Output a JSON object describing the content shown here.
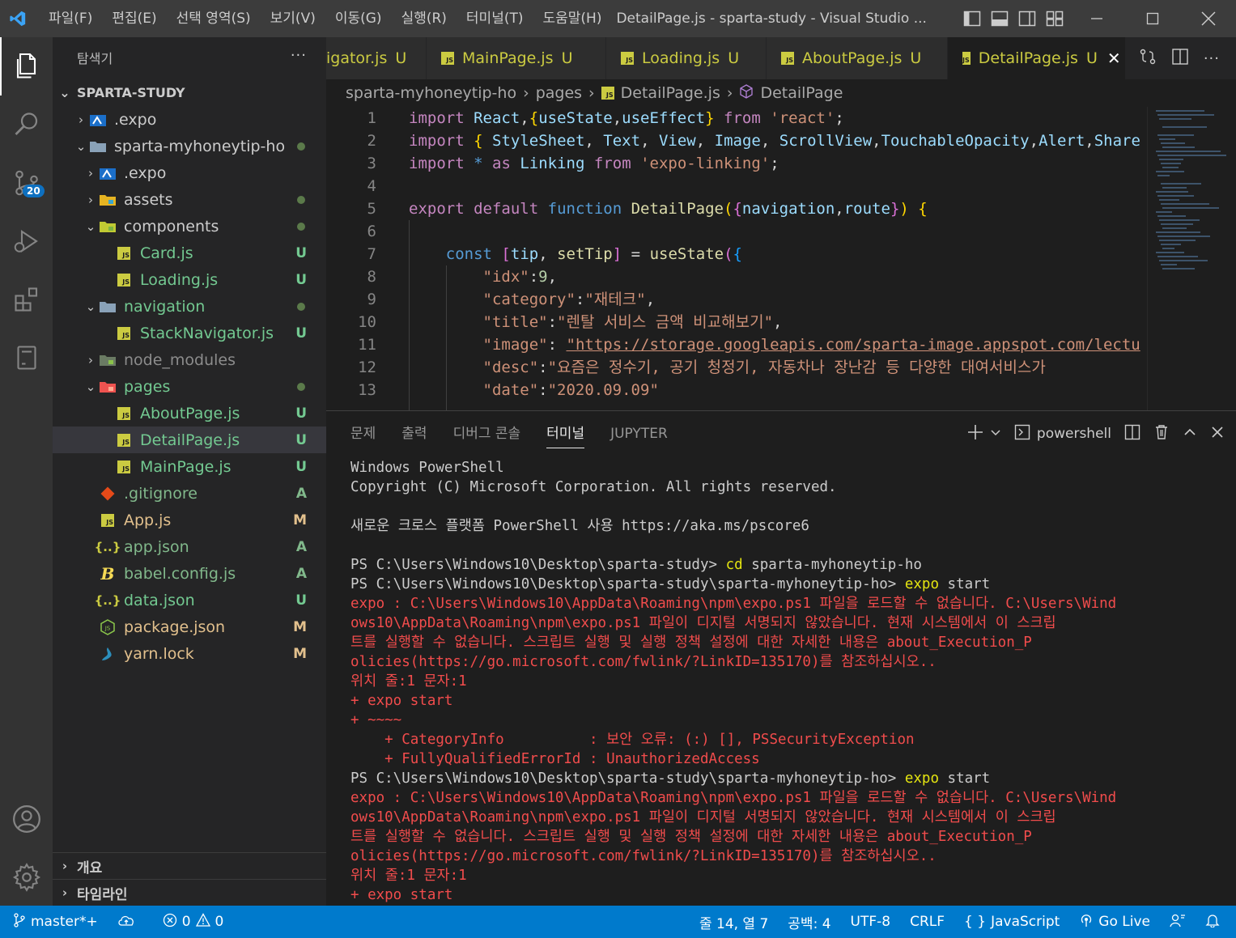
{
  "titlebar": {
    "menus": [
      "파일(F)",
      "편집(E)",
      "선택 영역(S)",
      "보기(V)",
      "이동(G)",
      "실행(R)",
      "터미널(T)",
      "도움말(H)"
    ],
    "window_title": "DetailPage.js - sparta-study - Visual Studio ..."
  },
  "activity": {
    "source_control_badge": "20"
  },
  "sidebar": {
    "title": "탐색기",
    "more": "···",
    "root": "SPARTA-STUDY",
    "items": [
      {
        "label": ".expo",
        "status": "",
        "icon": "expo-folder-icon"
      },
      {
        "label": "sparta-myhoneytip-ho",
        "status": "",
        "icon": "folder-open-icon"
      },
      {
        "label": ".expo",
        "status": "",
        "icon": "expo-folder-icon"
      },
      {
        "label": "assets",
        "status": "",
        "icon": "assets-folder-icon"
      },
      {
        "label": "components",
        "status": "",
        "icon": "components-folder-icon"
      },
      {
        "label": "Card.js",
        "status": "U",
        "icon": "js-file-icon"
      },
      {
        "label": "Loading.js",
        "status": "U",
        "icon": "js-file-icon"
      },
      {
        "label": "navigation",
        "status": "",
        "icon": "folder-open-icon"
      },
      {
        "label": "StackNavigator.js",
        "status": "U",
        "icon": "js-file-icon"
      },
      {
        "label": "node_modules",
        "status": "",
        "icon": "node-modules-folder-icon"
      },
      {
        "label": "pages",
        "status": "",
        "icon": "pages-folder-icon"
      },
      {
        "label": "AboutPage.js",
        "status": "U",
        "icon": "js-file-icon"
      },
      {
        "label": "DetailPage.js",
        "status": "U",
        "icon": "js-file-icon"
      },
      {
        "label": "MainPage.js",
        "status": "U",
        "icon": "js-file-icon"
      },
      {
        "label": ".gitignore",
        "status": "A",
        "icon": "git-icon"
      },
      {
        "label": "App.js",
        "status": "M",
        "icon": "js-file-icon"
      },
      {
        "label": "app.json",
        "status": "A",
        "icon": "json-icon"
      },
      {
        "label": "babel.config.js",
        "status": "A",
        "icon": "babel-icon"
      },
      {
        "label": "data.json",
        "status": "U",
        "icon": "json-icon"
      },
      {
        "label": "package.json",
        "status": "M",
        "icon": "node-icon"
      },
      {
        "label": "yarn.lock",
        "status": "M",
        "icon": "yarn-icon"
      }
    ],
    "outline": "개요",
    "timeline": "타임라인"
  },
  "tabs": [
    {
      "label": "igator.js",
      "status": "U"
    },
    {
      "label": "MainPage.js",
      "status": "U"
    },
    {
      "label": "Loading.js",
      "status": "U"
    },
    {
      "label": "AboutPage.js",
      "status": "U"
    },
    {
      "label": "DetailPage.js",
      "status": "U"
    }
  ],
  "breadcrumb": [
    "sparta-myhoneytip-ho",
    "pages",
    "DetailPage.js",
    "DetailPage"
  ],
  "editor": {
    "line_numbers": [
      "1",
      "2",
      "3",
      "4",
      "5",
      "6",
      "7",
      "8",
      "9",
      "10",
      "11",
      "12",
      "13"
    ]
  },
  "panel": {
    "tabs": [
      "문제",
      "출력",
      "디버그 콘솔",
      "터미널",
      "JUPYTER"
    ],
    "active_tab": "터미널",
    "shell": "powershell",
    "terminal_lines": [
      {
        "text": "Windows PowerShell",
        "color": "white"
      },
      {
        "text": "Copyright (C) Microsoft Corporation. All rights reserved.",
        "color": "white"
      },
      {
        "text": "",
        "color": "white"
      },
      {
        "text": "새로운 크로스 플랫폼 PowerShell 사용 https://aka.ms/pscore6",
        "color": "white"
      },
      {
        "text": "",
        "color": "white"
      },
      {
        "text": "PS C:\\Users\\Windows10\\Desktop\\sparta-study> ",
        "cmd": "cd",
        "rest": " sparta-myhoneytip-ho",
        "color": "prompt"
      },
      {
        "text": "PS C:\\Users\\Windows10\\Desktop\\sparta-study\\sparta-myhoneytip-ho> ",
        "cmd": "expo",
        "rest": " start",
        "color": "prompt"
      },
      {
        "text": "expo : C:\\Users\\Windows10\\AppData\\Roaming\\npm\\expo.ps1 파일을 로드할 수 없습니다. C:\\Users\\Wind",
        "color": "red"
      },
      {
        "text": "ows10\\AppData\\Roaming\\npm\\expo.ps1 파일이 디지털 서명되지 않았습니다. 현재 시스템에서 이 스크립",
        "color": "red"
      },
      {
        "text": "트를 실행할 수 없습니다. 스크립트 실행 및 실행 정책 설정에 대한 자세한 내용은 about_Execution_P",
        "color": "red"
      },
      {
        "text": "olicies(https://go.microsoft.com/fwlink/?LinkID=135170)를 참조하십시오..",
        "color": "red"
      },
      {
        "text": "위치 줄:1 문자:1",
        "color": "red"
      },
      {
        "text": "+ expo start",
        "color": "red"
      },
      {
        "text": "+ ~~~~",
        "color": "red"
      },
      {
        "text": "    + CategoryInfo          : 보안 오류: (:) [], PSSecurityException",
        "color": "red"
      },
      {
        "text": "    + FullyQualifiedErrorId : UnauthorizedAccess",
        "color": "red"
      },
      {
        "text": "PS C:\\Users\\Windows10\\Desktop\\sparta-study\\sparta-myhoneytip-ho> ",
        "cmd": "expo",
        "rest": " start",
        "color": "prompt"
      },
      {
        "text": "expo : C:\\Users\\Windows10\\AppData\\Roaming\\npm\\expo.ps1 파일을 로드할 수 없습니다. C:\\Users\\Wind",
        "color": "red"
      },
      {
        "text": "ows10\\AppData\\Roaming\\npm\\expo.ps1 파일이 디지털 서명되지 않았습니다. 현재 시스템에서 이 스크립",
        "color": "red"
      },
      {
        "text": "트를 실행할 수 없습니다. 스크립트 실행 및 실행 정책 설정에 대한 자세한 내용은 about_Execution_P",
        "color": "red"
      },
      {
        "text": "olicies(https://go.microsoft.com/fwlink/?LinkID=135170)를 참조하십시오..",
        "color": "red"
      },
      {
        "text": "위치 줄:1 문자:1",
        "color": "red"
      },
      {
        "text": "+ expo start",
        "color": "red"
      }
    ]
  },
  "statusbar": {
    "branch": "master*+",
    "errors": "0",
    "warnings": "0",
    "position": "줄 14, 열 7",
    "indent": "공백: 4",
    "encoding": "UTF-8",
    "eol": "CRLF",
    "language": "JavaScript",
    "golive": "Go Live"
  },
  "colors": {
    "accent": "#007acc",
    "js_yellow": "#cbcb41",
    "error_red": "#f14c4c",
    "modified": "#e2c08d",
    "added": "#81b88b",
    "untracked": "#73c991"
  }
}
